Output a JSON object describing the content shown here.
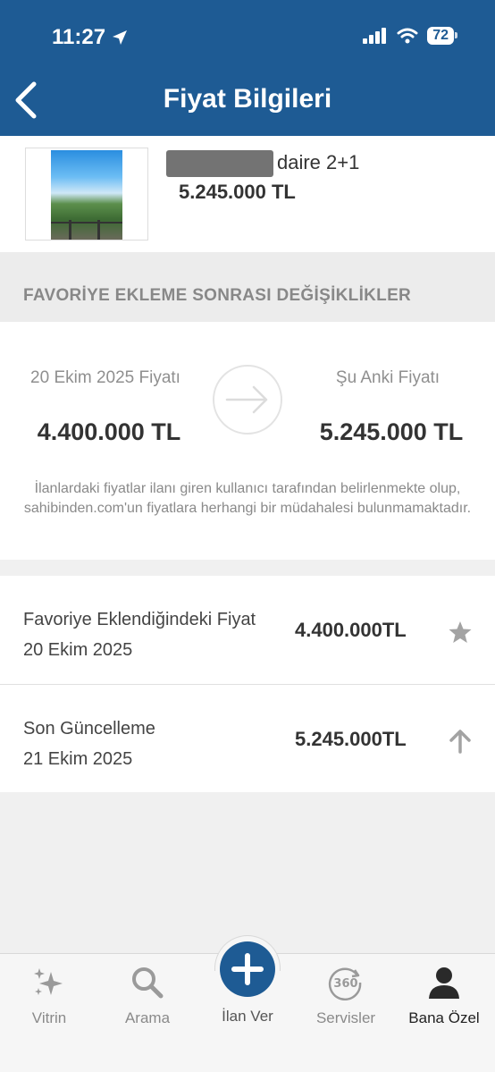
{
  "status_bar": {
    "time": "11:27",
    "battery": "72"
  },
  "header": {
    "title": "Fiyat Bilgileri"
  },
  "listing": {
    "title_suffix": "daire 2+1",
    "price": "5.245.000 TL"
  },
  "section": {
    "title": "FAVORİYE EKLEME SONRASI DEĞİŞİKLİKLER"
  },
  "comparison": {
    "old_label": "20 Ekim 2025 Fiyatı",
    "old_value": "4.400.000 TL",
    "new_label": "Şu Anki Fiyatı",
    "new_value": "5.245.000 TL",
    "disclaimer": "İlanlardaki fiyatlar ilanı giren kullanıcı tarafından belirlenmekte olup, sahibinden.com'un fiyatlara herhangi bir müdahalesi bulunmamaktadır."
  },
  "history": [
    {
      "title": "Favoriye Eklendiğindeki Fiyat",
      "date": "20 Ekim 2025",
      "price": "4.400.000TL",
      "icon": "star-icon"
    },
    {
      "title": "Son Güncelleme",
      "date": "21 Ekim 2025",
      "price": "5.245.000TL",
      "icon": "arrow-up-icon"
    }
  ],
  "tabbar": {
    "items": [
      {
        "label": "Vitrin",
        "icon": "sparkles-icon"
      },
      {
        "label": "Arama",
        "icon": "search-icon"
      },
      {
        "label": "İlan Ver",
        "icon": "plus-icon"
      },
      {
        "label": "Servisler",
        "icon": "360-icon"
      },
      {
        "label": "Bana Özel",
        "icon": "user-icon"
      }
    ],
    "active": "Bana Özel"
  },
  "colors": {
    "brand": "#1e5b94",
    "icon_gray": "#9a9a9a"
  }
}
